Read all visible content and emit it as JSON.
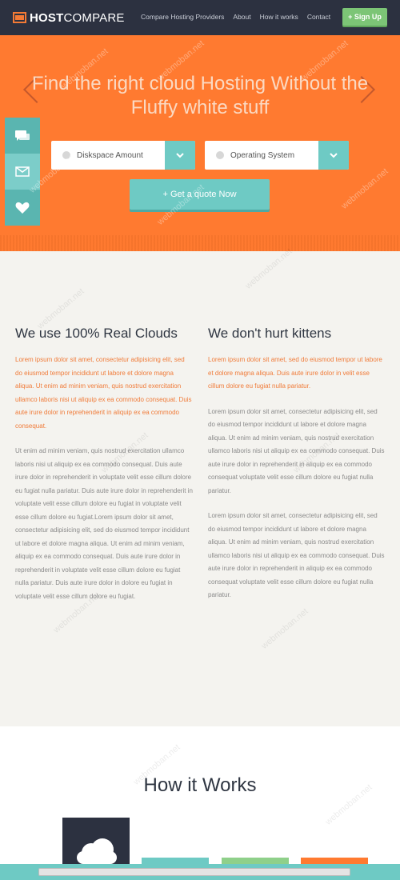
{
  "brand": {
    "bold": "HOST",
    "light": "COMPARE"
  },
  "nav": [
    "Compare Hosting Providers",
    "About",
    "How it works",
    "Contact"
  ],
  "signup_label": "+ Sign Up",
  "hero": {
    "title": "Find the right cloud Hosting Without the Fluffy white stuff",
    "select_disk": "Diskspace Amount",
    "select_os": "Operating System",
    "quote_label": "+ Get a quote Now"
  },
  "side_icons": [
    "chat-icon",
    "mail-icon",
    "heart-icon"
  ],
  "left_col": {
    "title": "We use 100% Real Clouds",
    "p1": "Lorem ipsum dolor sit amet, consectetur adipisicing elit, sed do eiusmod tempor incididunt ut labore et dolore magna aliqua. Ut enim ad minim veniam, quis nostrud exercitation ullamco laboris nisi ut aliquip ex ea commodo consequat. Duis aute irure dolor in reprehenderit in aliquip ex ea commodo consequat.",
    "p2": "Ut enim ad minim veniam, quis nostrud exercitation ullamco laboris nisi ut aliquip ex ea commodo consequat. Duis aute irure dolor in reprehenderit in voluptate velit esse cillum dolore eu fugiat nulla pariatur. Duis aute irure dolor in reprehenderit in voluptate velit esse cillum dolore eu fugiat in voluptate velit esse cillum dolore eu fugiat.Lorem ipsum dolor sit amet, consectetur adipisicing elit, sed do eiusmod tempor incididunt ut labore et dolore magna aliqua. Ut enim ad minim veniam, aliquip ex ea commodo consequat. Duis aute irure dolor in reprehenderit in voluptate velit esse cillum dolore eu fugiat nulla pariatur. Duis aute irure dolor in dolore eu fugiat in voluptate velit esse cillum dolore eu fugiat."
  },
  "right_col": {
    "title": "We don't hurt kittens",
    "p1": "Lorem ipsum dolor sit amet, sed do eiusmod tempor ut labore et dolore magna aliqua. Duis aute irure dolor in velit esse cillum dolore eu fugiat nulla pariatur.",
    "p2": "Lorem ipsum dolor sit amet, consectetur adipisicing elit, sed do eiusmod tempor incididunt ut labore et dolore magna aliqua. Ut enim ad minim veniam, quis nostrud exercitation ullamco laboris nisi ut aliquip ex ea commodo consequat. Duis aute irure dolor in reprehenderit in aliquip ex ea commodo consequat voluptate velit esse cillum dolore eu fugiat nulla pariatur.",
    "p3": "Lorem ipsum dolor sit amet, consectetur adipisicing elit, sed do eiusmod tempor incididunt ut labore et dolore magna aliqua. Ut enim ad minim veniam, quis nostrud exercitation ullamco laboris nisi ut aliquip ex ea commodo consequat. Duis aute irure dolor in reprehenderit in aliquip ex ea commodo consequat voluptate velit esse cillum dolore eu fugiat nulla pariatur."
  },
  "how": {
    "title": "How it Works"
  },
  "watermark": "webmoban.net",
  "colors": {
    "orange": "#ff7a30",
    "teal": "#6ecac4",
    "green": "#7cc576",
    "navy": "#2c3140"
  }
}
